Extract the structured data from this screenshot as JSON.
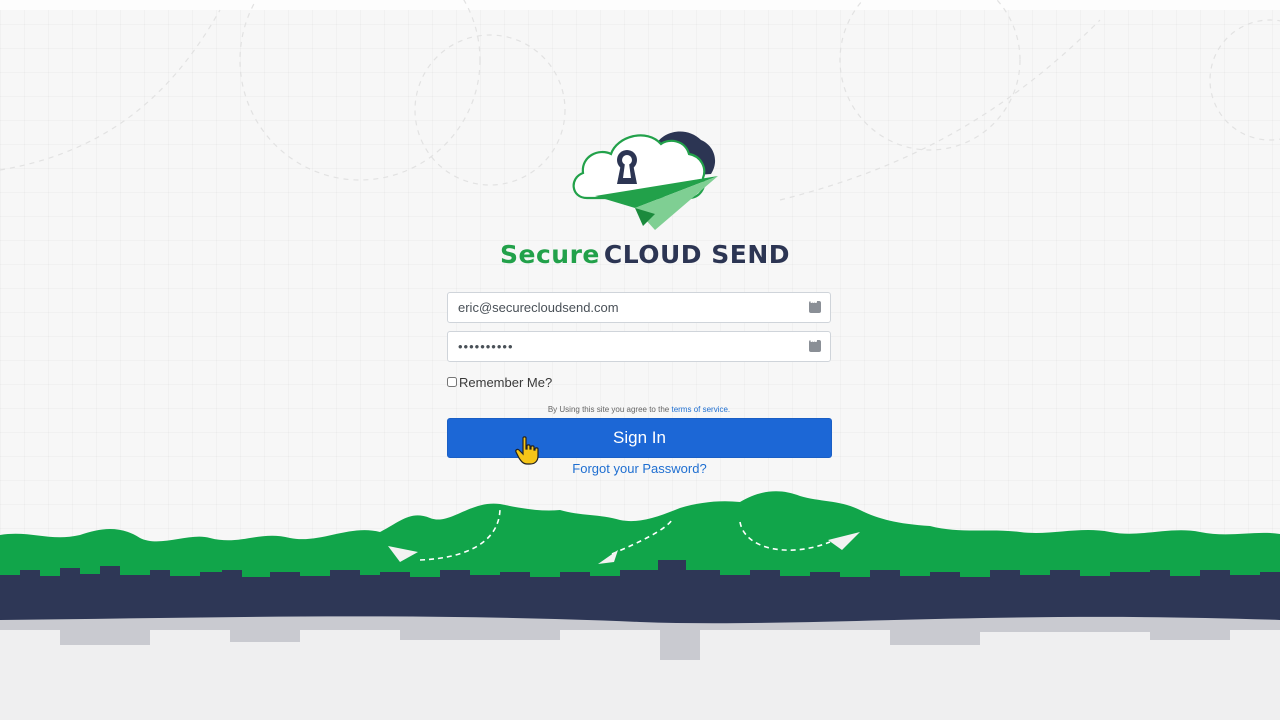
{
  "brand": {
    "word1": "Secure",
    "word2": "CLOUD SEND"
  },
  "form": {
    "email_value": "eric@securecloudsend.com",
    "password_value": "••••••••••",
    "remember_label": "Remember Me?",
    "remember_checked": false,
    "terms_prefix": "By Using this site you agree to the",
    "terms_link": "terms of service.",
    "signin_label": "Sign In",
    "forgot_label": "Forgot your Password?"
  },
  "icons": {
    "logo": "cloud-lock-paper-plane-icon",
    "field_key": "password-manager-icon",
    "cursor": "hand-pointer-icon"
  },
  "colors": {
    "brand_green": "#22a14a",
    "brand_navy": "#2c3553",
    "button_blue": "#1c67d6",
    "link_blue": "#1f6fd1",
    "hill_green": "#11a54a",
    "city_navy": "#2e3756"
  }
}
